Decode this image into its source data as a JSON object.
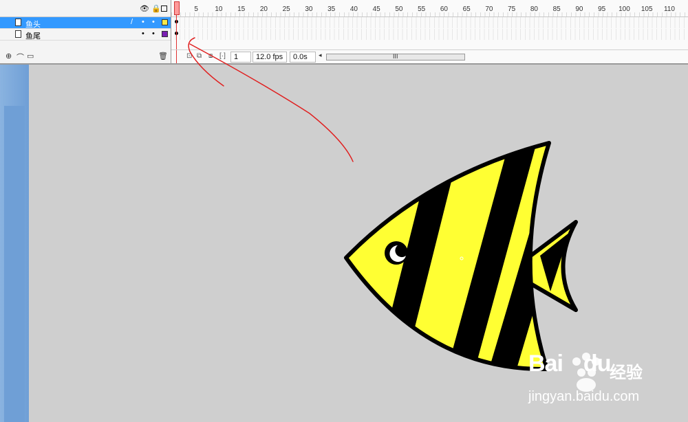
{
  "layers": [
    {
      "name": "鱼头",
      "selected": true,
      "color": "#f7e94a"
    },
    {
      "name": "鱼尾",
      "selected": false,
      "color": "#7a1fb2"
    }
  ],
  "timeline": {
    "ruler_ticks": [
      "5",
      "10",
      "15",
      "20",
      "25",
      "30",
      "35",
      "40",
      "45",
      "50",
      "55",
      "60",
      "65",
      "70",
      "75",
      "80",
      "85",
      "90",
      "95",
      "100",
      "105",
      "110"
    ],
    "current_frame": "1",
    "frame_rate": "12.0 fps",
    "elapsed_time": "0.0s",
    "scroll_grip": "III"
  },
  "header_icons": [
    "eye-icon",
    "lock-icon",
    "outline-icon"
  ],
  "footer_tools": [
    "add-layer-icon",
    "add-guide-layer-icon",
    "add-folder-icon",
    "delete-layer-icon"
  ],
  "stage": {
    "fish": {
      "body_color": "#ffff33",
      "stripe_color": "#000000",
      "outline_color": "#000000"
    },
    "annotation_color": "#e02020"
  },
  "watermark": {
    "logo": "Bai",
    "logo2": "du",
    "brand_cn": "经验",
    "url": "jingyan.baidu.com"
  }
}
